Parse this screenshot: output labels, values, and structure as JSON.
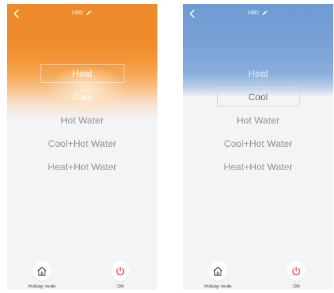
{
  "screens": [
    {
      "id": "heat-selected",
      "title": "HMI",
      "modes": [
        "Heat",
        "Cool",
        "Hot Water",
        "Cool+Hot Water",
        "Heat+Hot Water"
      ],
      "selected_mode": "Heat",
      "holiday_label": "Holiday mode",
      "power_label": "ON",
      "theme_color": "#f08a2a"
    },
    {
      "id": "cool-selected",
      "title": "HMI",
      "modes": [
        "Heat",
        "Cool",
        "Hot Water",
        "Cool+Hot Water",
        "Heat+Hot Water"
      ],
      "selected_mode": "Cool",
      "holiday_label": "Holiday mode",
      "power_label": "ON",
      "theme_color": "#78a0d6"
    }
  ],
  "icons": {
    "back": "chevron-left-icon",
    "edit": "pencil-icon",
    "holiday": "house-icon",
    "power": "power-icon"
  },
  "colors": {
    "power_icon": "#e3473c",
    "mode_text": "#8e9499"
  }
}
